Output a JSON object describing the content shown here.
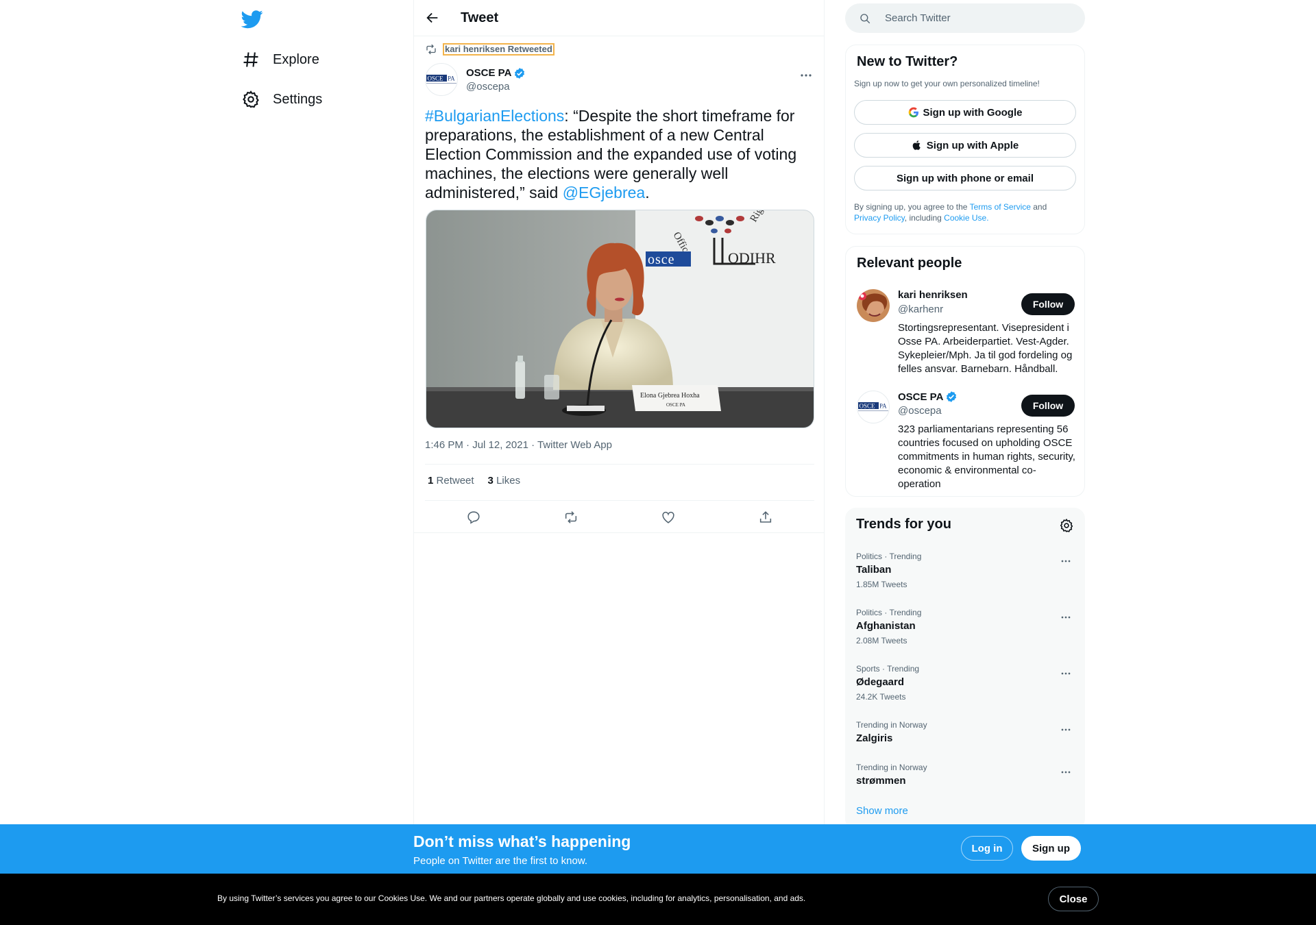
{
  "nav": {
    "items": [
      {
        "label": "Explore",
        "icon": "hashtag-icon"
      },
      {
        "label": "Settings",
        "icon": "gear-icon"
      }
    ]
  },
  "header": {
    "title": "Tweet"
  },
  "tweet": {
    "retweeted_by": "kari henriksen Retweeted",
    "author_name": "OSCE PA",
    "author_handle": "@oscepa",
    "text_hashtag": "#BulgarianElections",
    "text_body": ": “Despite the short timeframe for preparations, the establishment of a new Central Election Commission and the expanded use of voting machines, the elections were generally well administered,” said ",
    "text_mention": "@EGjebrea",
    "text_end": ".",
    "media": {
      "nameplate_line1": "Elona Gjebrea Hoxha",
      "nameplate_line2": "OSCE PA",
      "backdrop_osce": "osce",
      "backdrop_odihr": "ODIHR",
      "backdrop_office": "Office",
      "backdrop_rights": "Rights"
    },
    "meta": "1:46 PM · Jul 12, 2021 · Twitter Web App",
    "retweet_count": "1",
    "retweet_label": "Retweet",
    "like_count": "3",
    "like_label": "Likes"
  },
  "search": {
    "placeholder": "Search Twitter"
  },
  "new_to_twitter": {
    "title": "New to Twitter?",
    "subtitle": "Sign up now to get your own personalized timeline!",
    "google": "Sign up with Google",
    "apple": "Sign up with Apple",
    "phone": "Sign up with phone or email",
    "terms_1": "By signing up, you agree to the ",
    "terms_tos": "Terms of Service",
    "terms_2": " and ",
    "terms_privacy": "Privacy Policy",
    "terms_3": ", including ",
    "terms_cookie": "Cookie Use."
  },
  "relevant_people": {
    "title": "Relevant people",
    "people": [
      {
        "name": "kari henriksen",
        "handle": "@karhenr",
        "bio": "Stortingsrepresentant. Visepresident i Osse PA. Arbeiderpartiet. Vest-Agder. Sykepleier/Mph. Ja til god fordeling og felles ansvar. Barnebarn. Håndball.",
        "follow": "Follow"
      },
      {
        "name": "OSCE PA",
        "handle": "@oscepa",
        "bio": "323 parliamentarians representing 56 countries focused on upholding OSCE commitments in human rights, security, economic & environmental co-operation",
        "follow": "Follow"
      }
    ]
  },
  "trends": {
    "title": "Trends for you",
    "items": [
      {
        "context": "Politics · Trending",
        "name": "Taliban",
        "count": "1.85M Tweets"
      },
      {
        "context": "Politics · Trending",
        "name": "Afghanistan",
        "count": "2.08M Tweets"
      },
      {
        "context": "Sports · Trending",
        "name": "Ødegaard",
        "count": "24.2K Tweets"
      },
      {
        "context": "Trending in Norway",
        "name": "Zalgiris",
        "count": ""
      },
      {
        "context": "Trending in Norway",
        "name": "strømmen",
        "count": ""
      }
    ],
    "show_more": "Show more"
  },
  "bottom_bar": {
    "title": "Don’t miss what’s happening",
    "subtitle": "People on Twitter are the first to know.",
    "login": "Log in",
    "signup": "Sign up"
  },
  "cookie": {
    "text": "By using Twitter’s services you agree to our Cookies Use. We and our partners operate globally and use cookies, including for analytics, personalisation, and ads.",
    "close": "Close"
  },
  "colors": {
    "brand": "#1d9bf0",
    "text": "#0f1419",
    "muted": "#536471",
    "cookie_bg": "#000000"
  }
}
